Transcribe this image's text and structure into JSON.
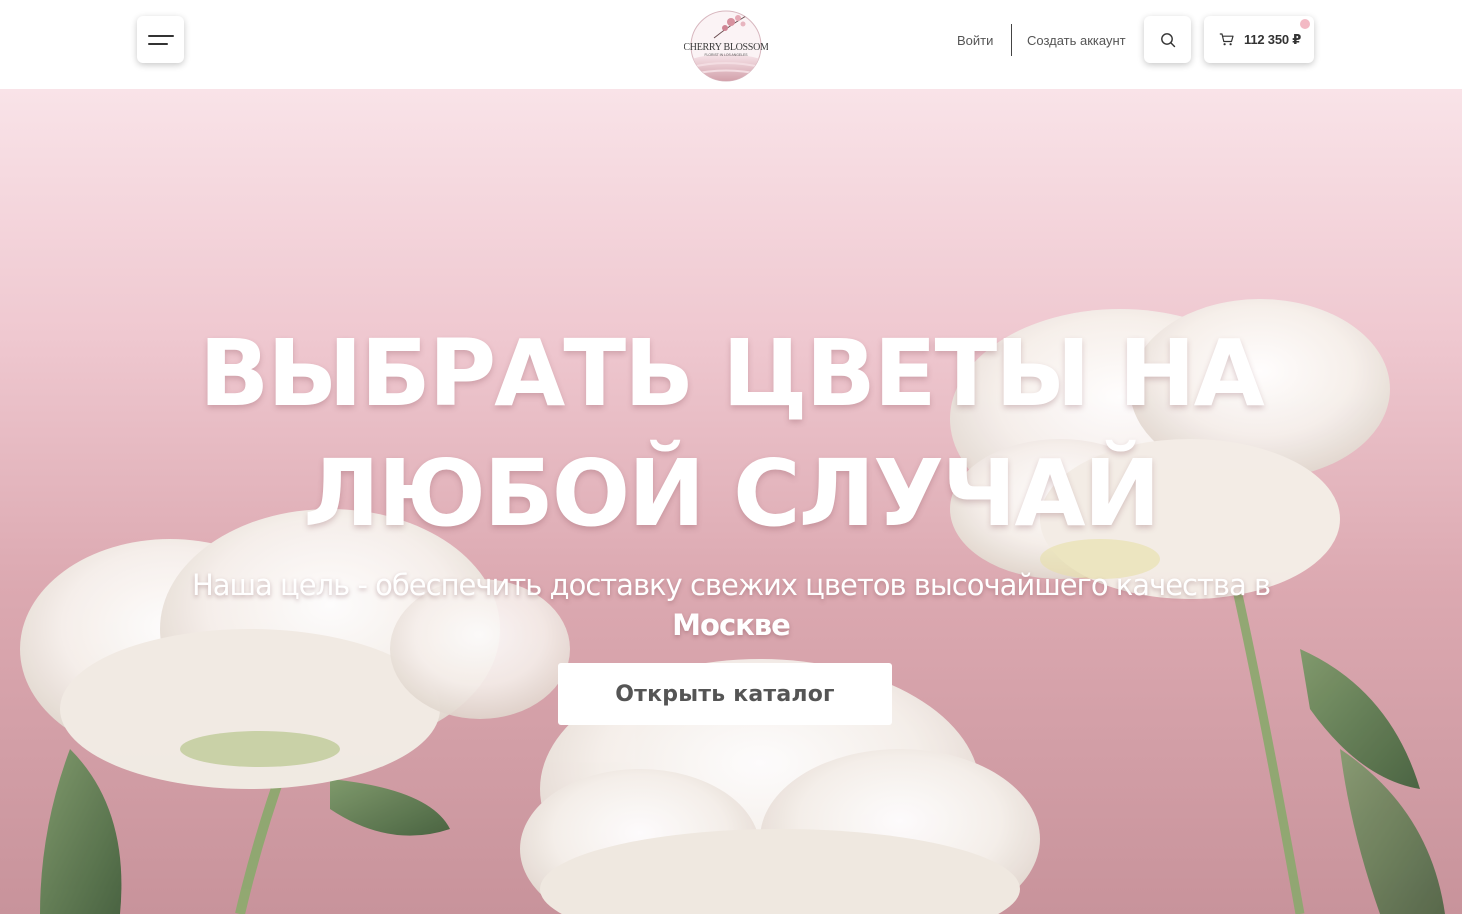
{
  "header": {
    "menu_icon": "hamburger-icon",
    "logo": {
      "name": "CHERRY BLOSSOM",
      "tagline": "FLORIST IN LOS ANGELES"
    },
    "login_label": "Войти",
    "register_label": "Создать аккаунт",
    "search_icon": "search-icon",
    "cart": {
      "icon": "cart-icon",
      "total": "112 350 ₽"
    }
  },
  "hero": {
    "title": "ВЫБРАТЬ ЦВЕТЫ НА ЛЮБОЙ СЛУЧАЙ",
    "subtitle_text": "Наша цель - обеспечить доставку свежих цветов высочайшего качества в",
    "subtitle_city": "Москве",
    "cta_label": "Открыть каталог"
  },
  "colors": {
    "hero_top": "#f9e3e8",
    "hero_bottom": "#c8939b",
    "text_dark": "#333333",
    "cart_dot": "#f3b9c4"
  }
}
